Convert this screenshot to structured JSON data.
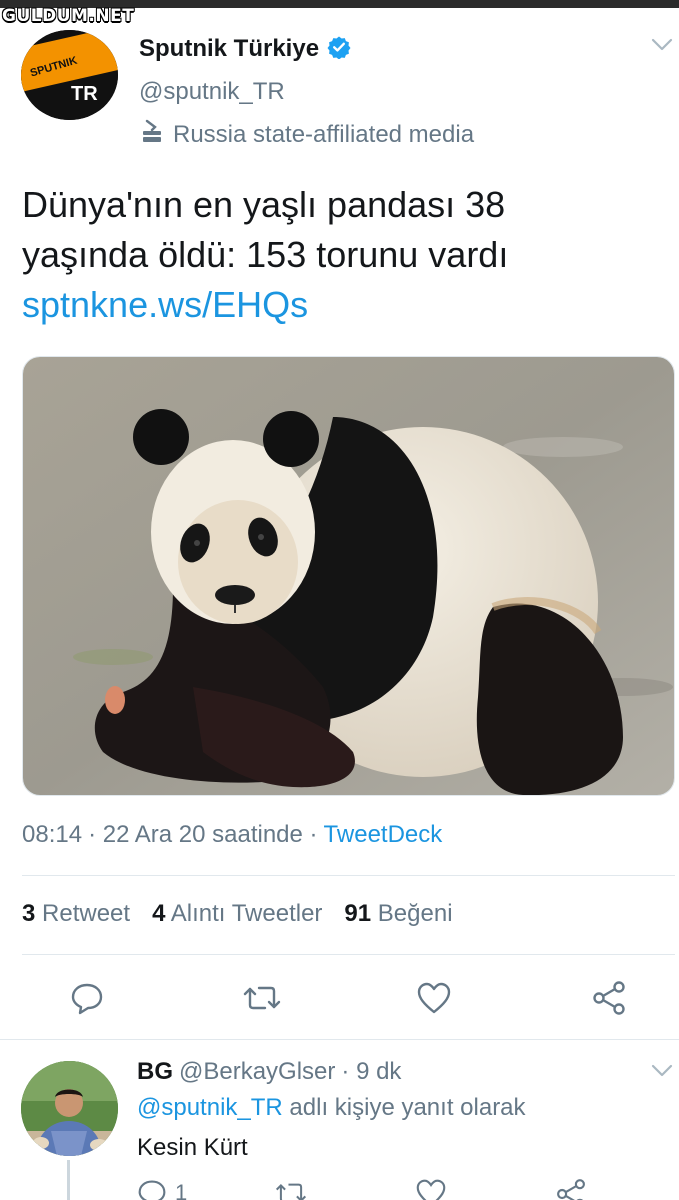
{
  "watermark": "GULDUM.NET",
  "tweet": {
    "account": {
      "display_name": "Sputnik Türkiye",
      "handle": "@sputnik_TR",
      "affiliation": "Russia state-affiliated media",
      "avatar_top_text": "SPUTNIK",
      "avatar_bottom_text": "TR"
    },
    "text_line1": "Dünya'nın en yaşlı pandası 38",
    "text_line2": "yaşında öldü: 153 torunu vardı",
    "link": "sptnkne.ws/EHQs",
    "time": "08:14",
    "date": "· 22 Ara 20 saatinde ·",
    "source": "TweetDeck",
    "stats": {
      "retweets_count": "3",
      "retweets_label": "Retweet",
      "quotes_count": "4",
      "quotes_label": "Alıntı Tweetler",
      "likes_count": "91",
      "likes_label": "Beğeni"
    }
  },
  "reply": {
    "name": "BG",
    "handle": "@BerkayGlser",
    "time": "· 9 dk",
    "replying_to_mention": "@sputnik_TR",
    "replying_to_suffix": " adlı kişiye yanıt olarak",
    "text": "Kesin Kürt",
    "reply_count": "1"
  },
  "colors": {
    "accent": "#1b95e0",
    "muted": "#657786",
    "text": "#14171a",
    "verified": "#1da1f2",
    "sputnik_orange": "#f39200"
  },
  "icons": {
    "verified": "verified-badge-icon",
    "state_media": "state-media-icon",
    "more": "chevron-down-icon",
    "reply": "reply-icon",
    "retweet": "retweet-icon",
    "like": "heart-icon",
    "share": "share-icon"
  }
}
